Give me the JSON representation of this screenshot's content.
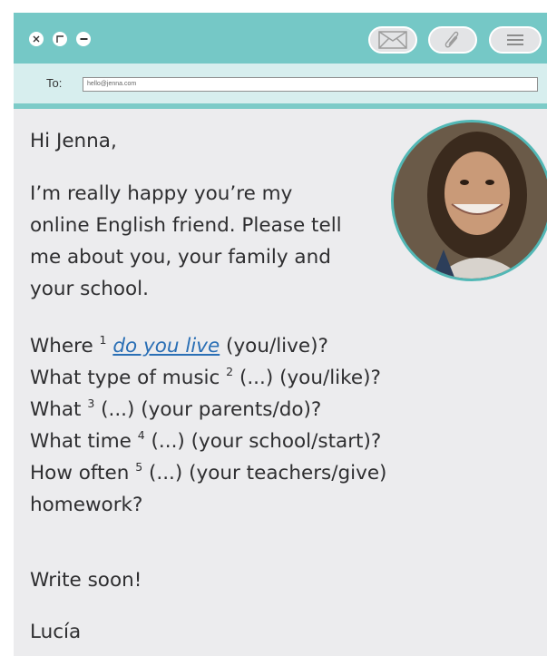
{
  "window_controls": {
    "close": "close-icon",
    "maximize": "maximize-icon",
    "minimize": "minimize-icon"
  },
  "toolbar": {
    "buttons": [
      "envelope-icon",
      "paperclip-icon",
      "menu-icon"
    ]
  },
  "email": {
    "to_label": "To:",
    "to_value": "hello@jenna.com"
  },
  "message": {
    "greeting": "Hi Jenna,",
    "intro_lines": [
      "I’m really happy you’re my",
      "online English friend. Please tell",
      "me about you, your family and",
      "your school."
    ],
    "questions": [
      {
        "before": "Where ",
        "num": "1",
        "gap": "do you live",
        "after": " (you/live)?"
      },
      {
        "before": "What type of music ",
        "num": "2",
        "gap": "(...)",
        "after": " (you/like)?"
      },
      {
        "before": "What ",
        "num": "3",
        "gap": "(...)",
        "after": " (your parents/do)?"
      },
      {
        "before": "What time ",
        "num": "4",
        "gap": "(...)",
        "after": " (your school/start)?"
      },
      {
        "before": "How often ",
        "num": "5",
        "gap": "(...)",
        "after": " (your teachers/give)"
      }
    ],
    "question_tail": "homework?",
    "closing": "Write soon!",
    "signature": "Lucía"
  },
  "colors": {
    "titlebar": "#75c8c6",
    "to_bar": "#d7eeee",
    "body_bg": "#ececee",
    "answer": "#2a6fb5"
  }
}
